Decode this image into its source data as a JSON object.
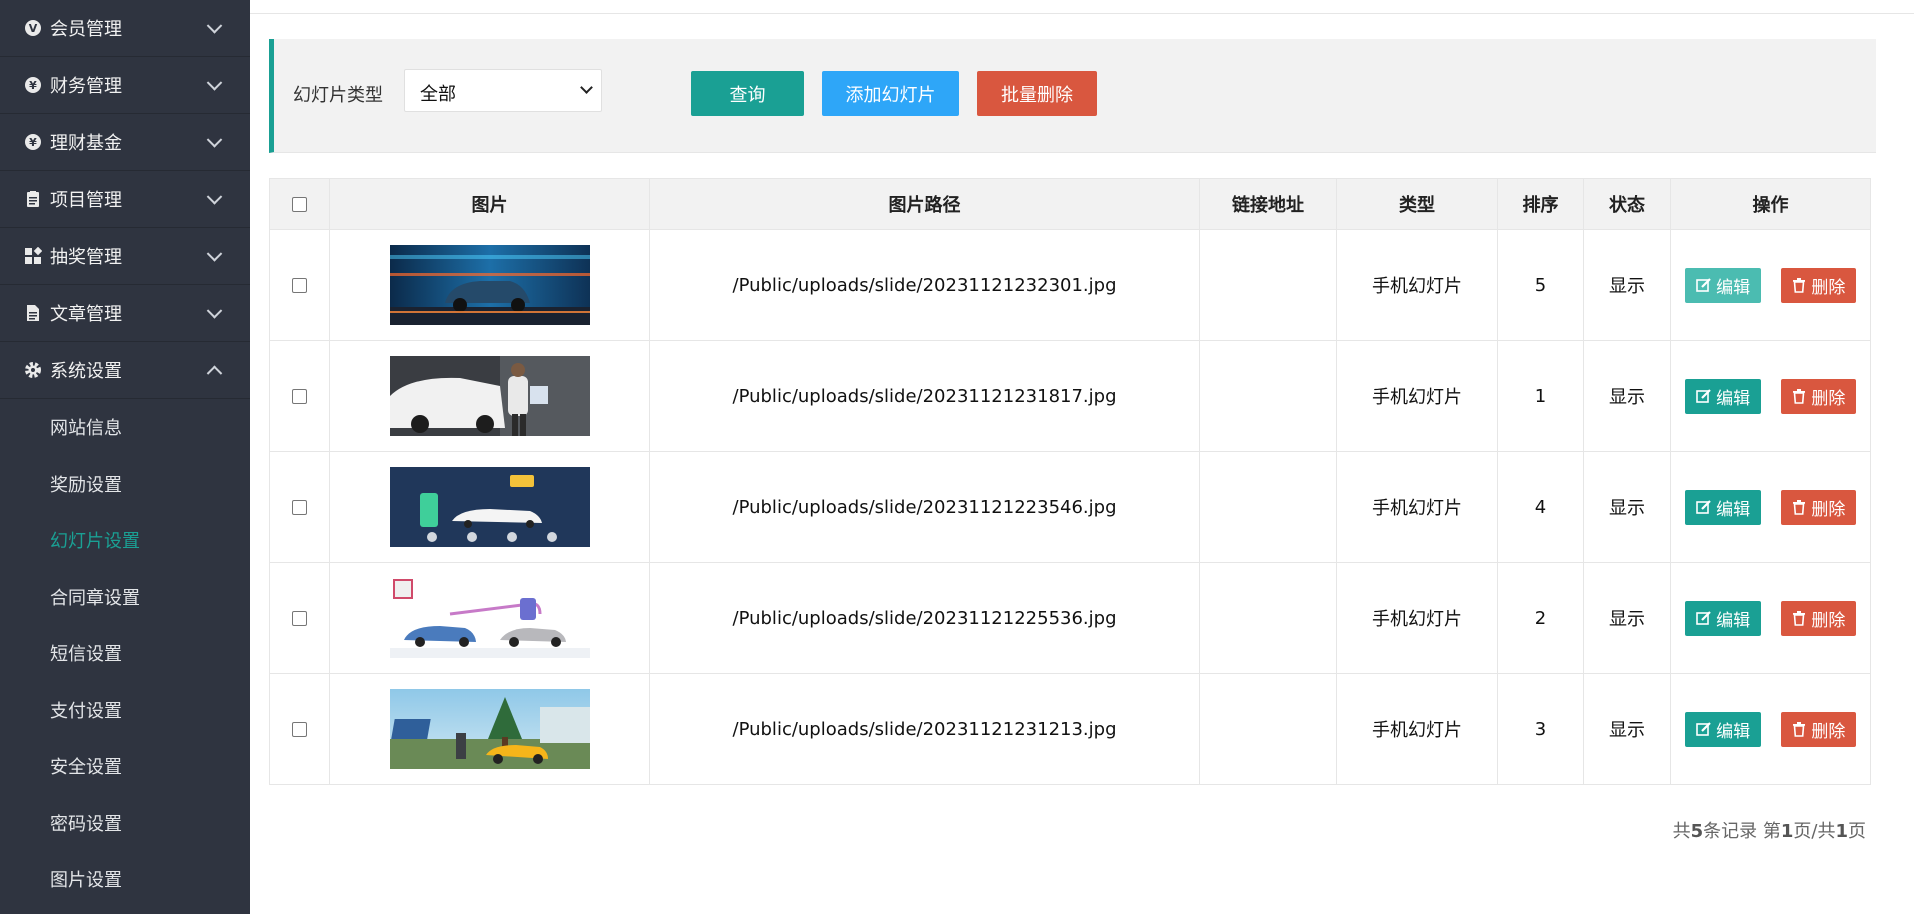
{
  "sidebar": {
    "menus": [
      {
        "label": "会员管理",
        "icon": "member-icon",
        "expanded": false
      },
      {
        "label": "财务管理",
        "icon": "finance-icon",
        "expanded": false
      },
      {
        "label": "理财基金",
        "icon": "fund-icon",
        "expanded": false
      },
      {
        "label": "项目管理",
        "icon": "project-icon",
        "expanded": false
      },
      {
        "label": "抽奖管理",
        "icon": "lottery-icon",
        "expanded": false
      },
      {
        "label": "文章管理",
        "icon": "article-icon",
        "expanded": false
      },
      {
        "label": "系统设置",
        "icon": "gear-icon",
        "expanded": true
      }
    ],
    "sub_items": [
      "网站信息",
      "奖励设置",
      "幻灯片设置",
      "合同章设置",
      "短信设置",
      "支付设置",
      "安全设置",
      "密码设置",
      "图片设置"
    ],
    "active_sub": "幻灯片设置"
  },
  "filter": {
    "label": "幻灯片类型",
    "select_value": "全部",
    "query_button": "查询",
    "add_button": "添加幻灯片",
    "batch_delete_button": "批量删除"
  },
  "table": {
    "headers": [
      "图片",
      "图片路径",
      "链接地址",
      "类型",
      "排序",
      "状态",
      "操作"
    ],
    "rows": [
      {
        "path": "/Public/uploads/slide/20231121232301.jpg",
        "link": "",
        "type": "手机幻灯片",
        "order": "5",
        "status": "显示"
      },
      {
        "path": "/Public/uploads/slide/20231121231817.jpg",
        "link": "",
        "type": "手机幻灯片",
        "order": "1",
        "status": "显示"
      },
      {
        "path": "/Public/uploads/slide/20231121223546.jpg",
        "link": "",
        "type": "手机幻灯片",
        "order": "4",
        "status": "显示"
      },
      {
        "path": "/Public/uploads/slide/20231121225536.jpg",
        "link": "",
        "type": "手机幻灯片",
        "order": "2",
        "status": "显示"
      },
      {
        "path": "/Public/uploads/slide/20231121231213.jpg",
        "link": "",
        "type": "手机幻灯片",
        "order": "3",
        "status": "显示"
      }
    ],
    "edit_label": "编辑",
    "delete_label": "删除"
  },
  "pager": {
    "p1": "共",
    "total": "5",
    "p2": "条记录 第",
    "page": "1",
    "p3": "页/共",
    "pages": "1",
    "p4": "页"
  },
  "colors": {
    "sidebar_bg": "#2f3440",
    "accent": "#1aa094",
    "add_blue": "#2ea6f8",
    "danger": "#d9573f"
  }
}
